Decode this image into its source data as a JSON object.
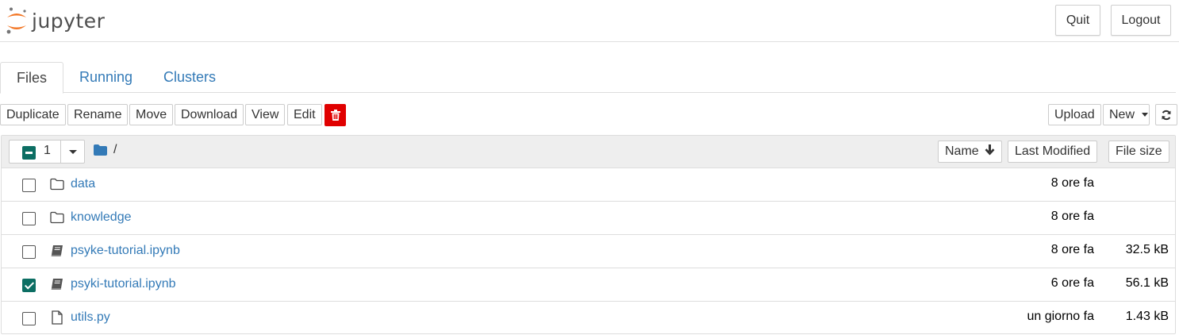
{
  "header": {
    "logo_text": "jupyter",
    "quit_label": "Quit",
    "logout_label": "Logout"
  },
  "tabs": [
    {
      "label": "Files",
      "active": true
    },
    {
      "label": "Running",
      "active": false
    },
    {
      "label": "Clusters",
      "active": false
    }
  ],
  "toolbar": {
    "actions": [
      "Duplicate",
      "Rename",
      "Move",
      "Download",
      "View",
      "Edit"
    ],
    "delete_icon": "trash-icon",
    "upload_label": "Upload",
    "new_label": "New",
    "refresh_icon": "refresh-icon"
  },
  "list_header": {
    "selected_count": "1",
    "path": "/",
    "sort_name": "Name",
    "sort_modified": "Last Modified",
    "sort_size": "File size"
  },
  "files": [
    {
      "name": "data",
      "type": "folder",
      "icon": "folder-icon",
      "modified": "8 ore fa",
      "size": "",
      "checked": false
    },
    {
      "name": "knowledge",
      "type": "folder",
      "icon": "folder-icon",
      "modified": "8 ore fa",
      "size": "",
      "checked": false
    },
    {
      "name": "psyke-tutorial.ipynb",
      "type": "notebook",
      "icon": "notebook-icon",
      "modified": "8 ore fa",
      "size": "32.5 kB",
      "checked": false
    },
    {
      "name": "psyki-tutorial.ipynb",
      "type": "notebook",
      "icon": "notebook-icon",
      "modified": "6 ore fa",
      "size": "56.1 kB",
      "checked": true
    },
    {
      "name": "utils.py",
      "type": "file",
      "icon": "file-icon",
      "modified": "un giorno fa",
      "size": "1.43 kB",
      "checked": false
    }
  ],
  "colors": {
    "accent": "#337ab7",
    "checkbox": "#0c6e63",
    "delete": "#e00000",
    "logo_orange": "#f37726"
  }
}
